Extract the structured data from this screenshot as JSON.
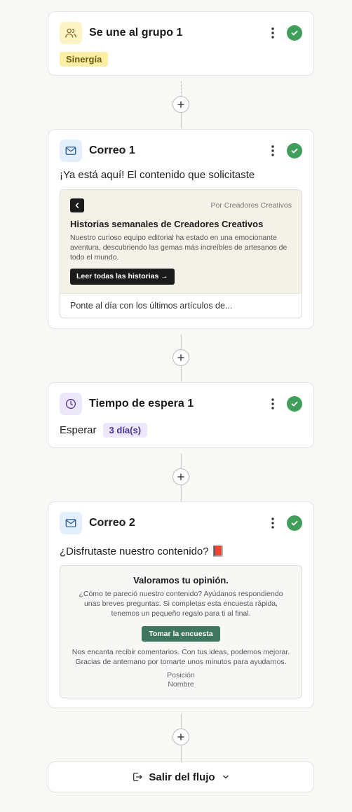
{
  "steps": {
    "group": {
      "title": "Se une al grupo 1",
      "tag": "Sinergía"
    },
    "email1": {
      "title": "Correo 1",
      "subject": "¡Ya está aquí! El contenido que solicitaste",
      "preview": {
        "byline": "Por Creadores Creativos",
        "heading": "Historias semanales de Creadores Creativos",
        "body": "Nuestro curioso equipo editorial ha estado en una emocionante aventura, descubriendo las gemas más increíbles de artesanos de todo el mundo.",
        "button": "Leer todas las historias →",
        "footer": "Ponte al día con los últimos artículos de..."
      }
    },
    "wait": {
      "title": "Tiempo de espera 1",
      "label": "Esperar",
      "value": "3 día(s)"
    },
    "email2": {
      "title": "Correo 2",
      "subject": "¿Disfrutaste nuestro contenido? 📕",
      "preview": {
        "heading": "Valoramos tu opinión.",
        "body": "¿Cómo te pareció nuestro contenido? Ayúdanos respondiendo unas breves preguntas. Si completas esta encuesta rápida, tenemos un pequeño regalo para ti al final.",
        "button": "Tomar la encuesta",
        "footer": "Nos encanta recibir comentarios. Con tus ideas, podemos mejorar. Gracias de antemano por tomarte unos minutos para ayudarnos.",
        "position": "Posición",
        "name": "Nombre"
      }
    },
    "exit": {
      "label": "Salir del flujo"
    }
  },
  "colors": {
    "success": "#3f9e5a",
    "tag_yellow_bg": "#fcefa3",
    "tag_purple_bg": "#ece7fb",
    "cta_dark": "#1b1b1b",
    "cta_green": "#3e7660"
  },
  "icons": [
    "users-icon",
    "mail-icon",
    "clock-icon",
    "kebab-menu-icon",
    "check-icon",
    "plus-icon",
    "chevron-left-icon",
    "logout-icon",
    "chevron-down-icon"
  ]
}
